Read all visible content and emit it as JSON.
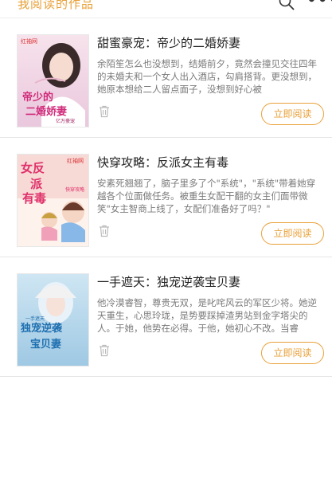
{
  "header": {
    "title": "我阅读的作品",
    "search_icon": "search-icon",
    "more_icon": "more-icon",
    "more_text": "•••"
  },
  "colors": {
    "accent": "#e8a038",
    "title_text": "#222222",
    "desc_text": "#7a7a7a",
    "divider": "#e6e6e6"
  },
  "books": [
    {
      "title": "甜蜜豪宠：帝少的二婚娇妻",
      "description": "余陌笙怎么也没想到，结婚前夕，竟然会撞见交往四年的未婚夫和一个女人出入酒店，勾肩搭背。更没想到，她原本想给二人留点面子，没想到好心被",
      "cover_text_main": "帝少的二婚娇妻",
      "cover_publisher": "红袖网",
      "cover_subtitle": "亿万豪宠",
      "read_label": "立即阅读",
      "trash_icon": "trash-icon"
    },
    {
      "title": "快穿攻略：反派女主有毒",
      "description": "安素死翘翘了，脑子里多了个\"系统\"，\"系统\"带着她穿越各个位面做任务。被重生女配干翻的女主们面带微笑\"女主智商上线了，女配们准备好了吗？\"",
      "cover_text_main": "反派女主有毒",
      "cover_publisher": "红袖网",
      "cover_subtitle": "快穿攻略",
      "read_label": "立即阅读",
      "trash_icon": "trash-icon"
    },
    {
      "title": "一手遮天：独宠逆袭宝贝妻",
      "description": "他冷漠睿智，尊贵无双，是叱咤风云的军区少将。她逆天重生，心思玲珑，是势要踩掉渣男站到金字塔尖的人。于她，他势在必得。于他，她初心不改。当睿",
      "cover_text_main": "独宠逆袭宝贝妻",
      "cover_publisher": "",
      "cover_subtitle": "一手遮天",
      "read_label": "立即阅读",
      "trash_icon": "trash-icon"
    }
  ]
}
